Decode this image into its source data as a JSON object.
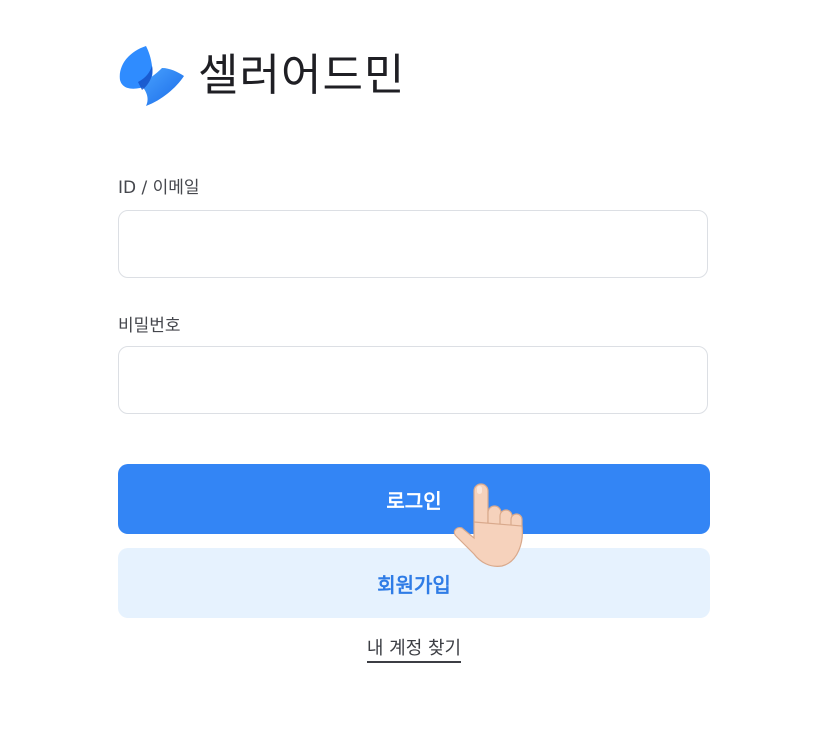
{
  "brand": {
    "name": "셀러어드민",
    "logo_icon": "leaf-logo-icon",
    "colors": {
      "primary": "#3385f5",
      "dark": "#1d5fd8"
    }
  },
  "login_form": {
    "id_label": "ID / 이메일",
    "id_value": "",
    "password_label": "비밀번호",
    "password_value": "",
    "login_button": "로그인",
    "signup_button": "회원가입",
    "find_account_link": "내 계정 찾기"
  },
  "pointer": {
    "icon": "pointing-hand-cursor-icon"
  }
}
